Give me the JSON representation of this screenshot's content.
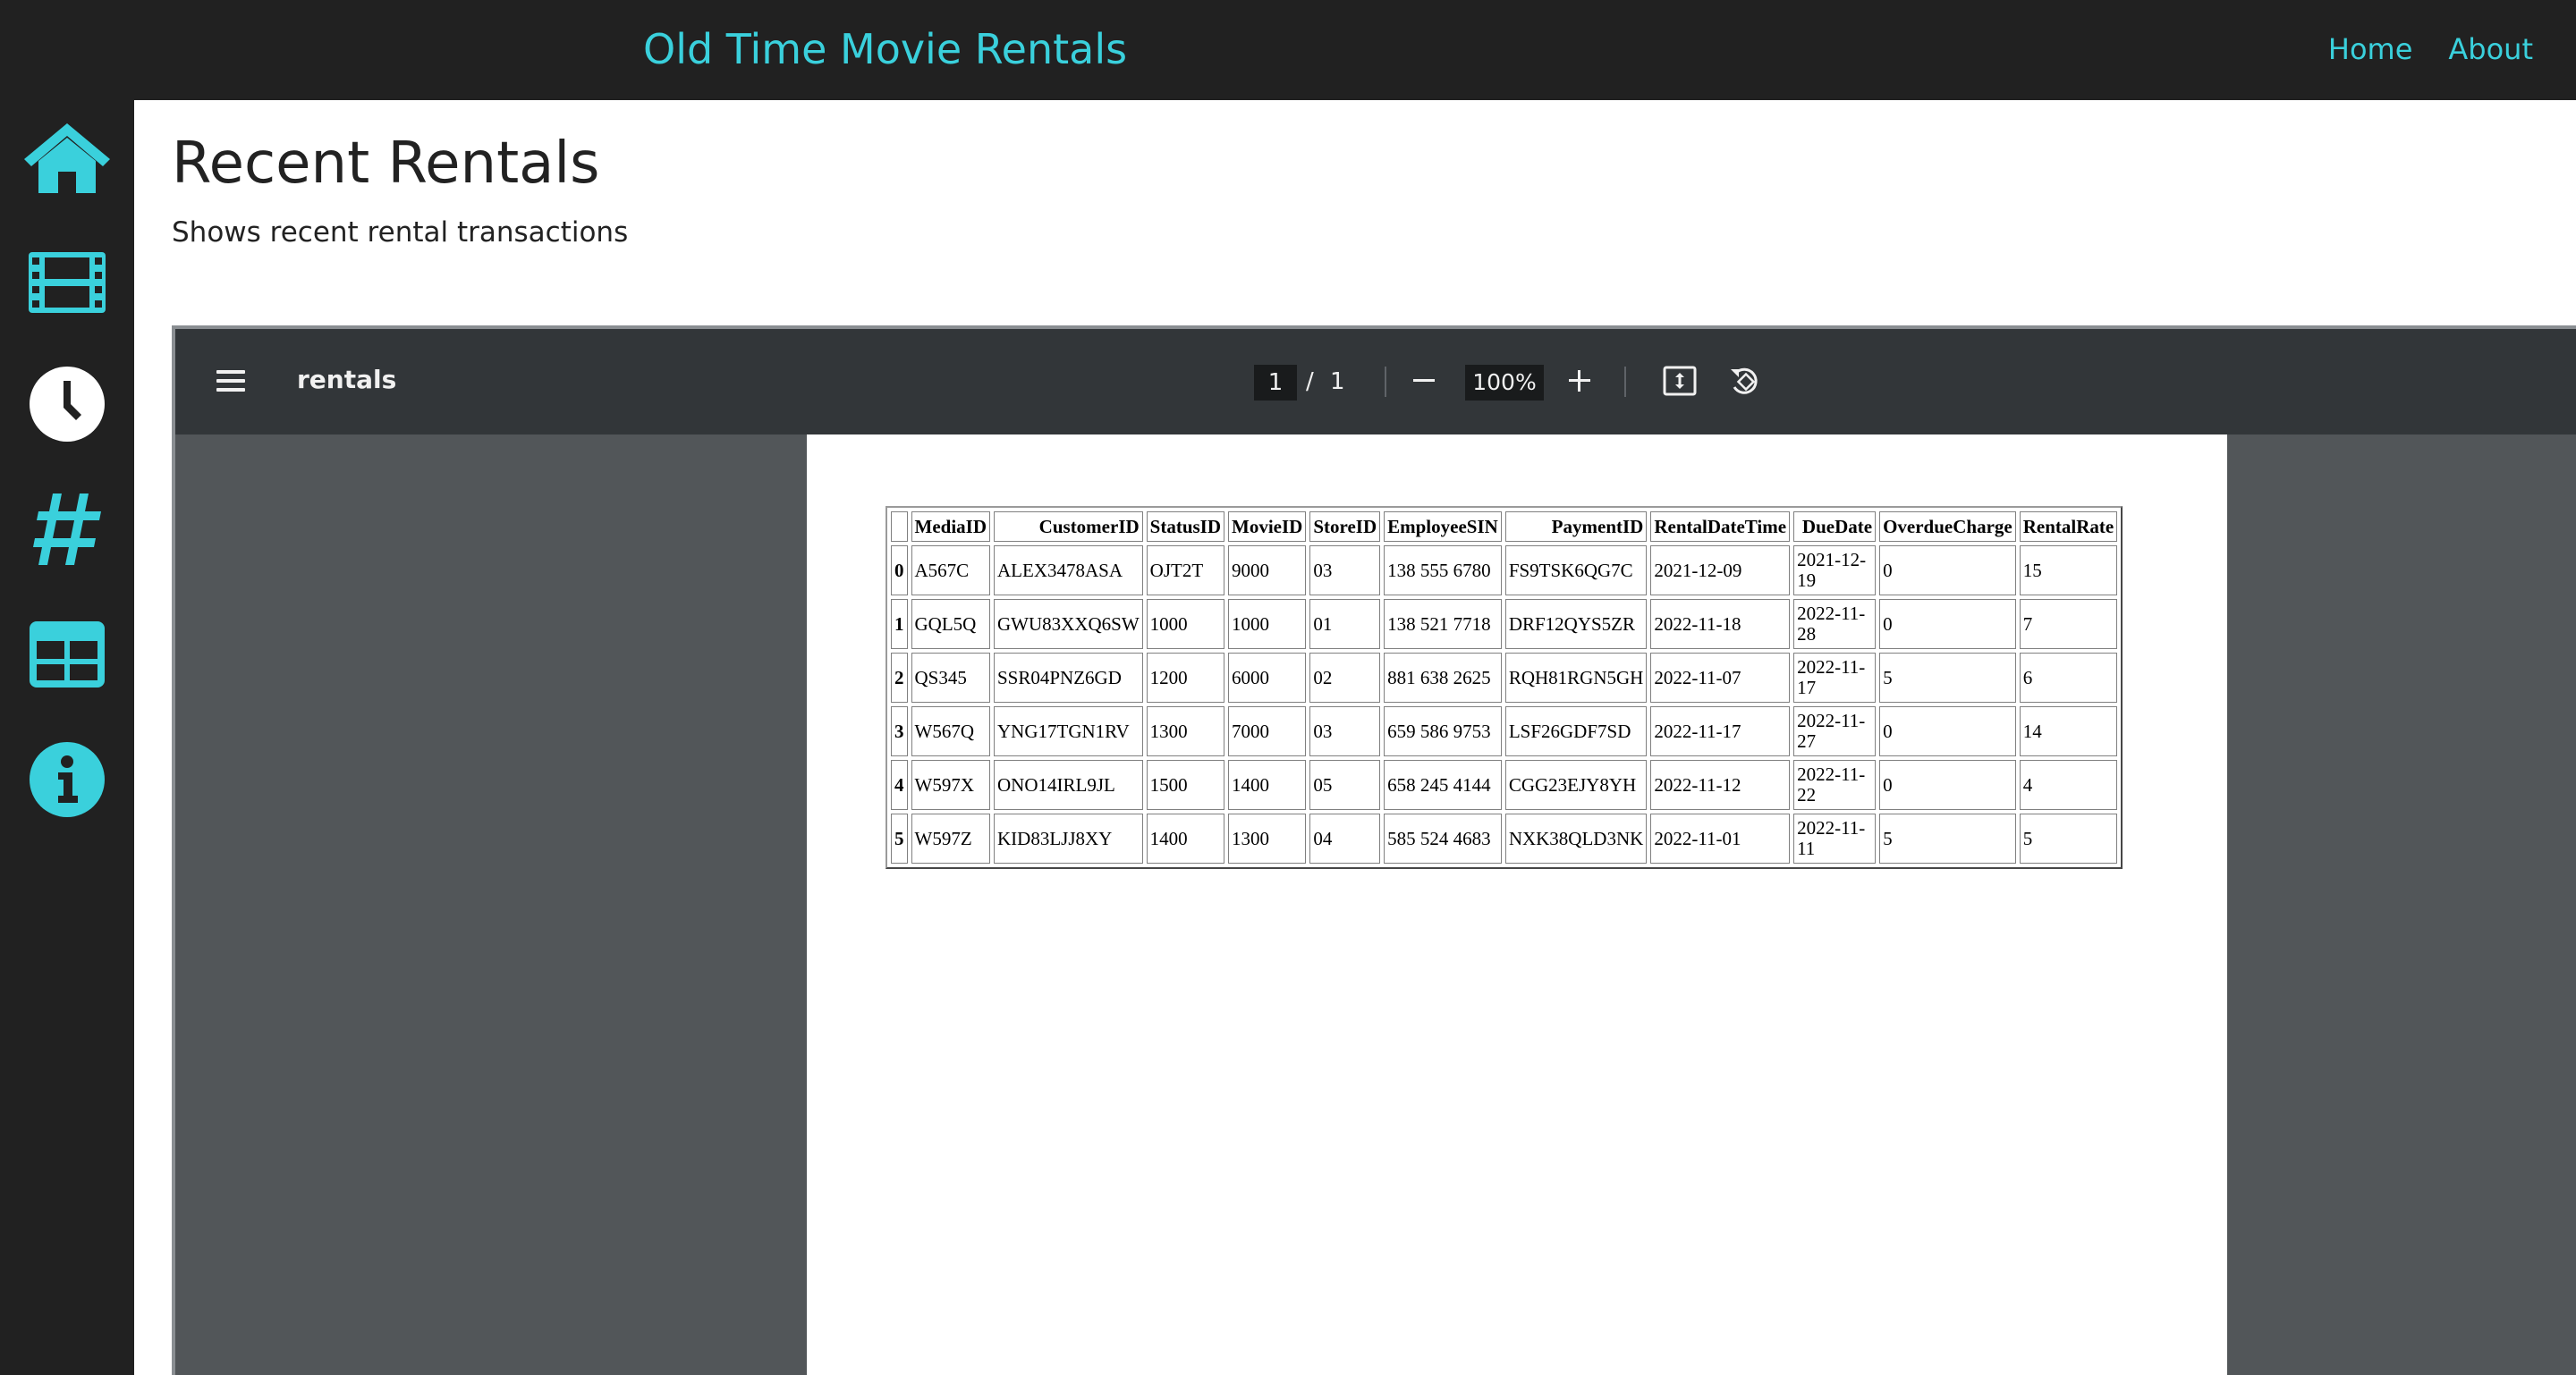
{
  "app": {
    "brand": "Old Time Movie Rentals",
    "nav": [
      {
        "label": "Home"
      },
      {
        "label": "About"
      }
    ],
    "accent_color": "#3ad0dc",
    "sidebar_icons": [
      "home-icon",
      "film-icon",
      "clock-icon",
      "hashtag-icon",
      "table-icon",
      "info-icon"
    ]
  },
  "page": {
    "title": "Recent Rentals",
    "subtitle": "Shows recent rental transactions"
  },
  "viewer": {
    "doc_title": "rentals",
    "current_page": "1",
    "page_separator": "/",
    "total_pages": "1",
    "zoom": "100%"
  },
  "table": {
    "headers": [
      "",
      "MediaID",
      "CustomerID",
      "StatusID",
      "MovieID",
      "StoreID",
      "EmployeeSIN",
      "PaymentID",
      "RentalDateTime",
      "DueDate",
      "OverdueCharge",
      "RentalRate"
    ],
    "rows": [
      [
        "0",
        "A567C",
        "ALEX3478ASA",
        "OJT2T",
        "9000",
        "03",
        "138 555 6780",
        "FS9TSK6QG7C",
        "2021-12-09",
        "2021-12-19",
        "0",
        "15"
      ],
      [
        "1",
        "GQL5Q",
        "GWU83XXQ6SW",
        "1000",
        "1000",
        "01",
        "138 521 7718",
        "DRF12QYS5ZR",
        "2022-11-18",
        "2022-11-28",
        "0",
        "7"
      ],
      [
        "2",
        "QS345",
        "SSR04PNZ6GD",
        "1200",
        "6000",
        "02",
        "881 638 2625",
        "RQH81RGN5GH",
        "2022-11-07",
        "2022-11-17",
        "5",
        "6"
      ],
      [
        "3",
        "W567Q",
        "YNG17TGN1RV",
        "1300",
        "7000",
        "03",
        "659 586 9753",
        "LSF26GDF7SD",
        "2022-11-17",
        "2022-11-27",
        "0",
        "14"
      ],
      [
        "4",
        "W597X",
        "ONO14IRL9JL",
        "1500",
        "1400",
        "05",
        "658 245 4144",
        "CGG23EJY8YH",
        "2022-11-12",
        "2022-11-22",
        "0",
        "4"
      ],
      [
        "5",
        "W597Z",
        "KID83LJJ8XY",
        "1400",
        "1300",
        "04",
        "585 524 4683",
        "NXK38QLD3NK",
        "2022-11-01",
        "2022-11-11",
        "5",
        "5"
      ]
    ]
  }
}
